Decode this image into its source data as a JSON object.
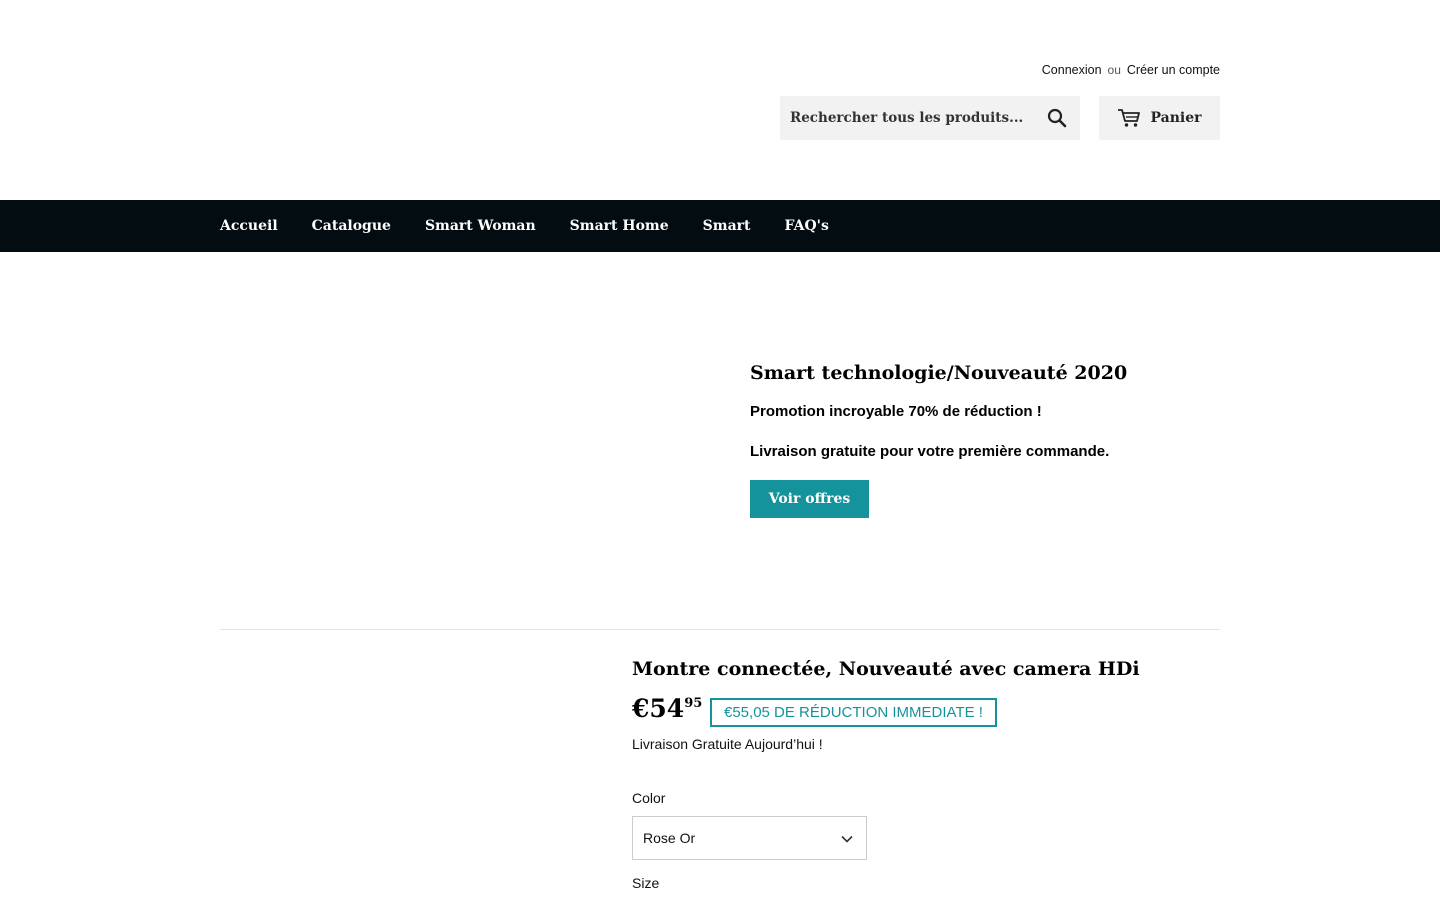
{
  "header": {
    "login_label": "Connexion",
    "separator": "ou",
    "register_label": "Créer un compte",
    "search": {
      "placeholder": "Rechercher tous les produits...",
      "icon": "search-icon"
    },
    "cart": {
      "label": "Panier",
      "icon": "cart-icon"
    }
  },
  "nav": {
    "items": [
      {
        "label": "Accueil"
      },
      {
        "label": "Catalogue"
      },
      {
        "label": "Smart Woman"
      },
      {
        "label": "Smart Home"
      },
      {
        "label": "Smart"
      },
      {
        "label": "FAQ's"
      }
    ],
    "background": "#030c10"
  },
  "hero": {
    "title": "Smart technologie/Nouveauté 2020",
    "line1": "Promotion incroyable 70% de réduction  !",
    "line2": "Livraison gratuite pour votre première commande.",
    "button_label": "Voir offres",
    "accent": "#15939c"
  },
  "product": {
    "title": "Montre connectée, Nouveauté avec camera HDi",
    "price_main": "€54",
    "price_cents": "95",
    "discount_badge": "€55,05 DE RÉDUCTION IMMEDIATE !",
    "shipping_note": "Livraison Gratuite Aujourd’hui !",
    "color_label": "Color",
    "color_value": "Rose Or",
    "size_label": "Size"
  }
}
